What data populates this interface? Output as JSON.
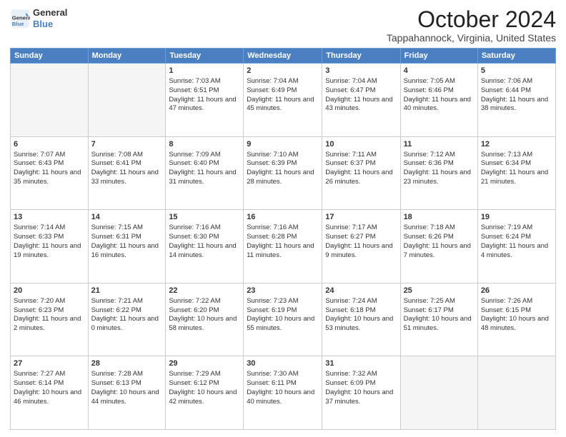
{
  "header": {
    "logo_line1": "General",
    "logo_line2": "Blue",
    "title": "October 2024",
    "subtitle": "Tappahannock, Virginia, United States"
  },
  "days_of_week": [
    "Sunday",
    "Monday",
    "Tuesday",
    "Wednesday",
    "Thursday",
    "Friday",
    "Saturday"
  ],
  "weeks": [
    [
      {
        "day": "",
        "sunrise": "",
        "sunset": "",
        "daylight": ""
      },
      {
        "day": "",
        "sunrise": "",
        "sunset": "",
        "daylight": ""
      },
      {
        "day": "1",
        "sunrise": "Sunrise: 7:03 AM",
        "sunset": "Sunset: 6:51 PM",
        "daylight": "Daylight: 11 hours and 47 minutes."
      },
      {
        "day": "2",
        "sunrise": "Sunrise: 7:04 AM",
        "sunset": "Sunset: 6:49 PM",
        "daylight": "Daylight: 11 hours and 45 minutes."
      },
      {
        "day": "3",
        "sunrise": "Sunrise: 7:04 AM",
        "sunset": "Sunset: 6:47 PM",
        "daylight": "Daylight: 11 hours and 43 minutes."
      },
      {
        "day": "4",
        "sunrise": "Sunrise: 7:05 AM",
        "sunset": "Sunset: 6:46 PM",
        "daylight": "Daylight: 11 hours and 40 minutes."
      },
      {
        "day": "5",
        "sunrise": "Sunrise: 7:06 AM",
        "sunset": "Sunset: 6:44 PM",
        "daylight": "Daylight: 11 hours and 38 minutes."
      }
    ],
    [
      {
        "day": "6",
        "sunrise": "Sunrise: 7:07 AM",
        "sunset": "Sunset: 6:43 PM",
        "daylight": "Daylight: 11 hours and 35 minutes."
      },
      {
        "day": "7",
        "sunrise": "Sunrise: 7:08 AM",
        "sunset": "Sunset: 6:41 PM",
        "daylight": "Daylight: 11 hours and 33 minutes."
      },
      {
        "day": "8",
        "sunrise": "Sunrise: 7:09 AM",
        "sunset": "Sunset: 6:40 PM",
        "daylight": "Daylight: 11 hours and 31 minutes."
      },
      {
        "day": "9",
        "sunrise": "Sunrise: 7:10 AM",
        "sunset": "Sunset: 6:39 PM",
        "daylight": "Daylight: 11 hours and 28 minutes."
      },
      {
        "day": "10",
        "sunrise": "Sunrise: 7:11 AM",
        "sunset": "Sunset: 6:37 PM",
        "daylight": "Daylight: 11 hours and 26 minutes."
      },
      {
        "day": "11",
        "sunrise": "Sunrise: 7:12 AM",
        "sunset": "Sunset: 6:36 PM",
        "daylight": "Daylight: 11 hours and 23 minutes."
      },
      {
        "day": "12",
        "sunrise": "Sunrise: 7:13 AM",
        "sunset": "Sunset: 6:34 PM",
        "daylight": "Daylight: 11 hours and 21 minutes."
      }
    ],
    [
      {
        "day": "13",
        "sunrise": "Sunrise: 7:14 AM",
        "sunset": "Sunset: 6:33 PM",
        "daylight": "Daylight: 11 hours and 19 minutes."
      },
      {
        "day": "14",
        "sunrise": "Sunrise: 7:15 AM",
        "sunset": "Sunset: 6:31 PM",
        "daylight": "Daylight: 11 hours and 16 minutes."
      },
      {
        "day": "15",
        "sunrise": "Sunrise: 7:16 AM",
        "sunset": "Sunset: 6:30 PM",
        "daylight": "Daylight: 11 hours and 14 minutes."
      },
      {
        "day": "16",
        "sunrise": "Sunrise: 7:16 AM",
        "sunset": "Sunset: 6:28 PM",
        "daylight": "Daylight: 11 hours and 11 minutes."
      },
      {
        "day": "17",
        "sunrise": "Sunrise: 7:17 AM",
        "sunset": "Sunset: 6:27 PM",
        "daylight": "Daylight: 11 hours and 9 minutes."
      },
      {
        "day": "18",
        "sunrise": "Sunrise: 7:18 AM",
        "sunset": "Sunset: 6:26 PM",
        "daylight": "Daylight: 11 hours and 7 minutes."
      },
      {
        "day": "19",
        "sunrise": "Sunrise: 7:19 AM",
        "sunset": "Sunset: 6:24 PM",
        "daylight": "Daylight: 11 hours and 4 minutes."
      }
    ],
    [
      {
        "day": "20",
        "sunrise": "Sunrise: 7:20 AM",
        "sunset": "Sunset: 6:23 PM",
        "daylight": "Daylight: 11 hours and 2 minutes."
      },
      {
        "day": "21",
        "sunrise": "Sunrise: 7:21 AM",
        "sunset": "Sunset: 6:22 PM",
        "daylight": "Daylight: 11 hours and 0 minutes."
      },
      {
        "day": "22",
        "sunrise": "Sunrise: 7:22 AM",
        "sunset": "Sunset: 6:20 PM",
        "daylight": "Daylight: 10 hours and 58 minutes."
      },
      {
        "day": "23",
        "sunrise": "Sunrise: 7:23 AM",
        "sunset": "Sunset: 6:19 PM",
        "daylight": "Daylight: 10 hours and 55 minutes."
      },
      {
        "day": "24",
        "sunrise": "Sunrise: 7:24 AM",
        "sunset": "Sunset: 6:18 PM",
        "daylight": "Daylight: 10 hours and 53 minutes."
      },
      {
        "day": "25",
        "sunrise": "Sunrise: 7:25 AM",
        "sunset": "Sunset: 6:17 PM",
        "daylight": "Daylight: 10 hours and 51 minutes."
      },
      {
        "day": "26",
        "sunrise": "Sunrise: 7:26 AM",
        "sunset": "Sunset: 6:15 PM",
        "daylight": "Daylight: 10 hours and 48 minutes."
      }
    ],
    [
      {
        "day": "27",
        "sunrise": "Sunrise: 7:27 AM",
        "sunset": "Sunset: 6:14 PM",
        "daylight": "Daylight: 10 hours and 46 minutes."
      },
      {
        "day": "28",
        "sunrise": "Sunrise: 7:28 AM",
        "sunset": "Sunset: 6:13 PM",
        "daylight": "Daylight: 10 hours and 44 minutes."
      },
      {
        "day": "29",
        "sunrise": "Sunrise: 7:29 AM",
        "sunset": "Sunset: 6:12 PM",
        "daylight": "Daylight: 10 hours and 42 minutes."
      },
      {
        "day": "30",
        "sunrise": "Sunrise: 7:30 AM",
        "sunset": "Sunset: 6:11 PM",
        "daylight": "Daylight: 10 hours and 40 minutes."
      },
      {
        "day": "31",
        "sunrise": "Sunrise: 7:32 AM",
        "sunset": "Sunset: 6:09 PM",
        "daylight": "Daylight: 10 hours and 37 minutes."
      },
      {
        "day": "",
        "sunrise": "",
        "sunset": "",
        "daylight": ""
      },
      {
        "day": "",
        "sunrise": "",
        "sunset": "",
        "daylight": ""
      }
    ]
  ]
}
